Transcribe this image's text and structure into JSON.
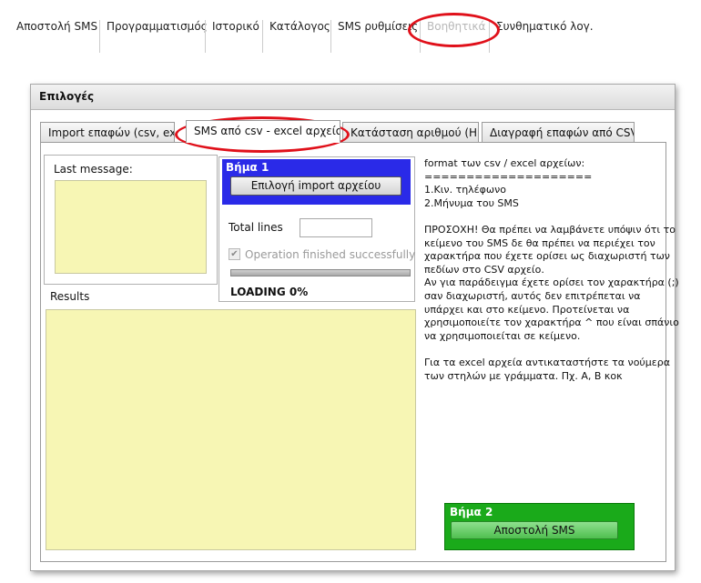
{
  "menu": {
    "items": [
      {
        "label": "Αποστολή SMS"
      },
      {
        "label": "Προγραμματισμός"
      },
      {
        "label": "Ιστορικό"
      },
      {
        "label": "Κατάλογος"
      },
      {
        "label": "SMS ρυθμίσεις"
      },
      {
        "label": "Βοηθητικά",
        "disabled": true
      },
      {
        "label": "Συνθηματικό λογ."
      }
    ]
  },
  "panel": {
    "title": "Επιλογές",
    "tabs": [
      {
        "label": "Import επαφών (csv, excel)"
      },
      {
        "label": "SMS από csv - excel αρχείο",
        "active": true
      },
      {
        "label": "Κατάσταση αριθμού (HLR)"
      },
      {
        "label": "Διαγραφή επαφών από CSV"
      }
    ]
  },
  "last_message": {
    "label": "Last message:"
  },
  "step1": {
    "title": "Βήμα 1",
    "button_label": "Επιλογή import αρχείου",
    "total_lines_label": "Total lines",
    "total_lines_value": "",
    "operation_label": "Operation finished successfully",
    "operation_checked": true,
    "progress": 0,
    "loading_text": "LOADING 0%"
  },
  "results": {
    "label": "Results"
  },
  "info": {
    "lines": [
      "format των csv / excel αρχείων:",
      "====================",
      "1.Κιν. τηλέφωνο",
      "2.Μήνυμα του SMS",
      "",
      "ΠΡΟΣΟΧΗ! Θα πρέπει να λαμβάνετε υπόψιν ότι το κείμενο του SMS δε θα πρέπει να περιέχει τον χαρακτήρα που έχετε ορίσει ως διαχωριστή των πεδίων στο CSV αρχείο.",
      "Αν για παράδειγμα έχετε ορίσει τον χαρακτήρα (;) σαν διαχωριστή, αυτός δεν επιτρέπεται να υπάρχει και στο κείμενο. Προτείνεται να χρησιμοποιείτε τον χαρακτήρα ^ που είναι σπάνιο να χρησιμοποιείται σε κείμενο.",
      "",
      "Για τα excel αρχεία αντικαταστήστε τα νούμερα των στηλών με γράμματα. Πχ. Α, Β κοκ"
    ]
  },
  "step2": {
    "title": "Βήμα 2",
    "button_label": "Αποστολή SMS"
  },
  "colors": {
    "step1_bg": "#2a2ae8",
    "step2_bg": "#1aaa1a",
    "highlight": "#e0101a",
    "yellow": "#f7f6b4"
  }
}
